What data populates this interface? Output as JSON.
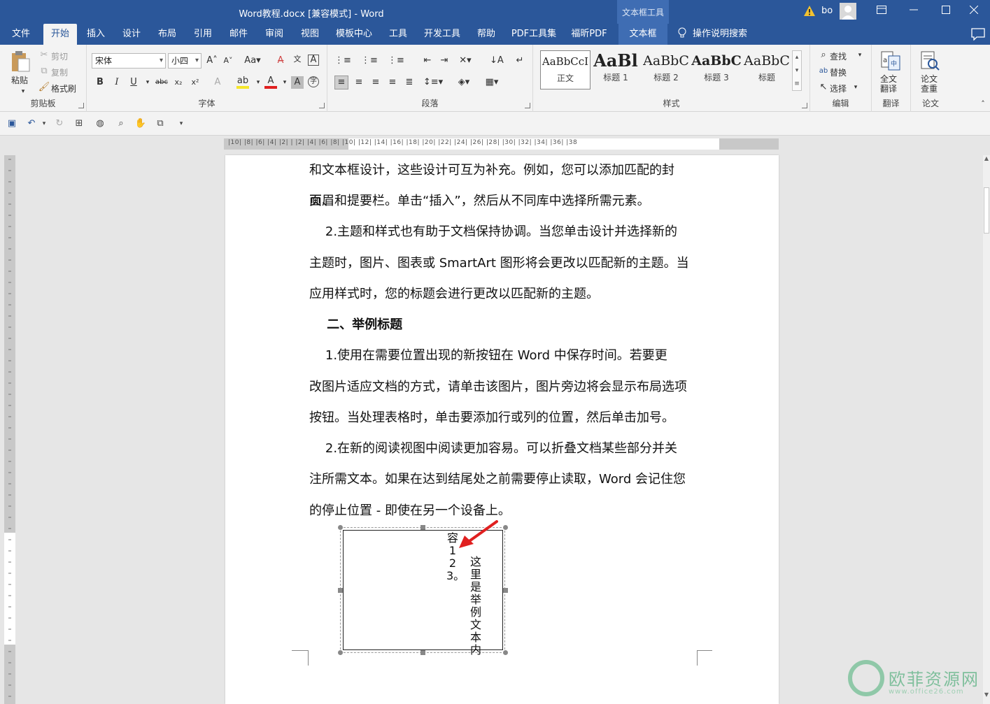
{
  "titlebar": {
    "title": "Word教程.docx [兼容模式]  -  Word",
    "context_tool": "文本框工具",
    "user": "bo"
  },
  "tabs": [
    "文件",
    "开始",
    "插入",
    "设计",
    "布局",
    "引用",
    "邮件",
    "审阅",
    "视图",
    "模板中心",
    "工具",
    "开发工具",
    "帮助",
    "PDF工具集",
    "福昕PDF",
    "文本框"
  ],
  "tell_me": "操作说明搜索",
  "ribbon": {
    "clipboard": {
      "label": "剪贴板",
      "paste": "粘贴",
      "cut": "剪切",
      "copy": "复制",
      "painter": "格式刷"
    },
    "font": {
      "label": "字体",
      "font_name": "宋体",
      "font_size": "小四"
    },
    "paragraph": {
      "label": "段落"
    },
    "styles": {
      "label": "样式",
      "items": [
        {
          "sample": "AaBbCcI",
          "name": "正文"
        },
        {
          "sample": "AaBl",
          "name": "标题 1"
        },
        {
          "sample": "AaBbC",
          "name": "标题 2"
        },
        {
          "sample": "AaBbC",
          "name": "标题 3"
        },
        {
          "sample": "AaBbC",
          "name": "标题"
        }
      ]
    },
    "editing": {
      "label": "编辑",
      "find": "查找",
      "replace": "替换",
      "select": "选择"
    },
    "translate": {
      "label": "翻译",
      "full": "全文\n翻译"
    },
    "paper": {
      "label": "论文",
      "check": "论文\n查重"
    }
  },
  "ruler": {
    "h_numbers": "|10|  |8|  |6|  |4|  |2|    |  |2|  |4|  |6|  |8|  |10|  |12|  |14|  |16|  |18|  |20|  |22|  |24|  |26|  |28|  |30|  |32|  |34|  |36|  |38"
  },
  "document": {
    "paragraphs": [
      "和文本框设计，这些设计可互为补充。例如，您可以添加匹配的封面、",
      "页眉和提要栏。单击“插入”，然后从不同库中选择所需元素。",
      "    2.主题和样式也有助于文档保持协调。当您单击设计并选择新的",
      "主题时，图片、图表或 SmartArt 图形将会更改以匹配新的主题。当",
      "应用样式时，您的标题会进行更改以匹配新的主题。",
      "    二、举例标题",
      "    1.使用在需要位置出现的新按钮在 Word 中保存时间。若要更",
      "改图片适应文档的方式，请单击该图片，图片旁边将会显示布局选项",
      "按钮。当处理表格时，单击要添加行或列的位置，然后单击加号。",
      "    2.在新的阅读视图中阅读更加容易。可以折叠文档某些部分并关",
      "注所需文本。如果在达到结尾处之前需要停止读取，Word 会记住您",
      "的停止位置 - 即使在另一个设备上。"
    ],
    "textbox": {
      "col1": "这里是举例文本内",
      "col2": "容123。"
    }
  },
  "watermark": {
    "cn": "欧菲资源网",
    "url": "www.office26.com"
  },
  "colors": {
    "accent": "#2b579a",
    "arrow": "#e02020"
  }
}
